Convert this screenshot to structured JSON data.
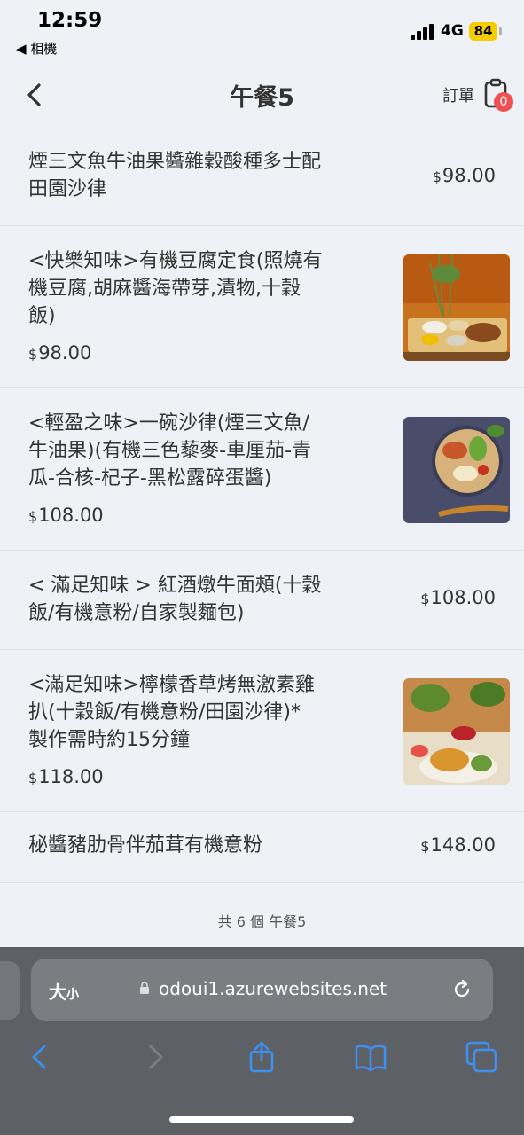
{
  "status_bar": {
    "time": "12:59",
    "back_app": "◀ 相機",
    "network": "4G",
    "battery": "84"
  },
  "header": {
    "title": "午餐5",
    "order_label": "訂單",
    "cart_count": "0"
  },
  "currency": "$",
  "items": [
    {
      "name_lines": [
        "煙三文魚牛油果醬雜穀酸種多士配",
        "田園沙律"
      ],
      "price": "98.00",
      "image": null
    },
    {
      "name_lines": [
        "<快樂知味>有機豆腐定食(照燒有",
        "機豆腐,胡麻醬海帶芽,漬物,十穀",
        "飯)"
      ],
      "price": "98.00",
      "image": "tofu-set-meal"
    },
    {
      "name_lines": [
        "<輕盈之味>一碗沙律(煙三文魚/",
        "牛油果)(有機三色藜麥-車厘茄-青",
        "瓜-合核-杞子-黑松露碎蛋醬)"
      ],
      "price": "108.00",
      "image": "salad-bowl"
    },
    {
      "name_lines": [
        "< 滿足知味 > 紅酒燉牛面頰(十穀",
        "飯/有機意粉/自家製麵包)"
      ],
      "price": "108.00",
      "image": null
    },
    {
      "name_lines": [
        "<滿足知味>檸檬香草烤無激素雞",
        "扒(十穀飯/有機意粉/田園沙律)*",
        "製作需時約15分鐘"
      ],
      "price": "118.00",
      "image": "chicken-plate"
    },
    {
      "name_lines": [
        "秘醬豬肋骨伴茄茸有機意粉"
      ],
      "price": "148.00",
      "image": null
    }
  ],
  "footer": {
    "count_text": "共 6 個 午餐5"
  },
  "browser": {
    "text_size_big": "大",
    "text_size_small": "小",
    "url": "odoui1.azurewebsites.net"
  },
  "colors": {
    "badge": "#f0504f",
    "battery": "#f5cc00",
    "toolbar_blue": "#3d8ff0"
  }
}
